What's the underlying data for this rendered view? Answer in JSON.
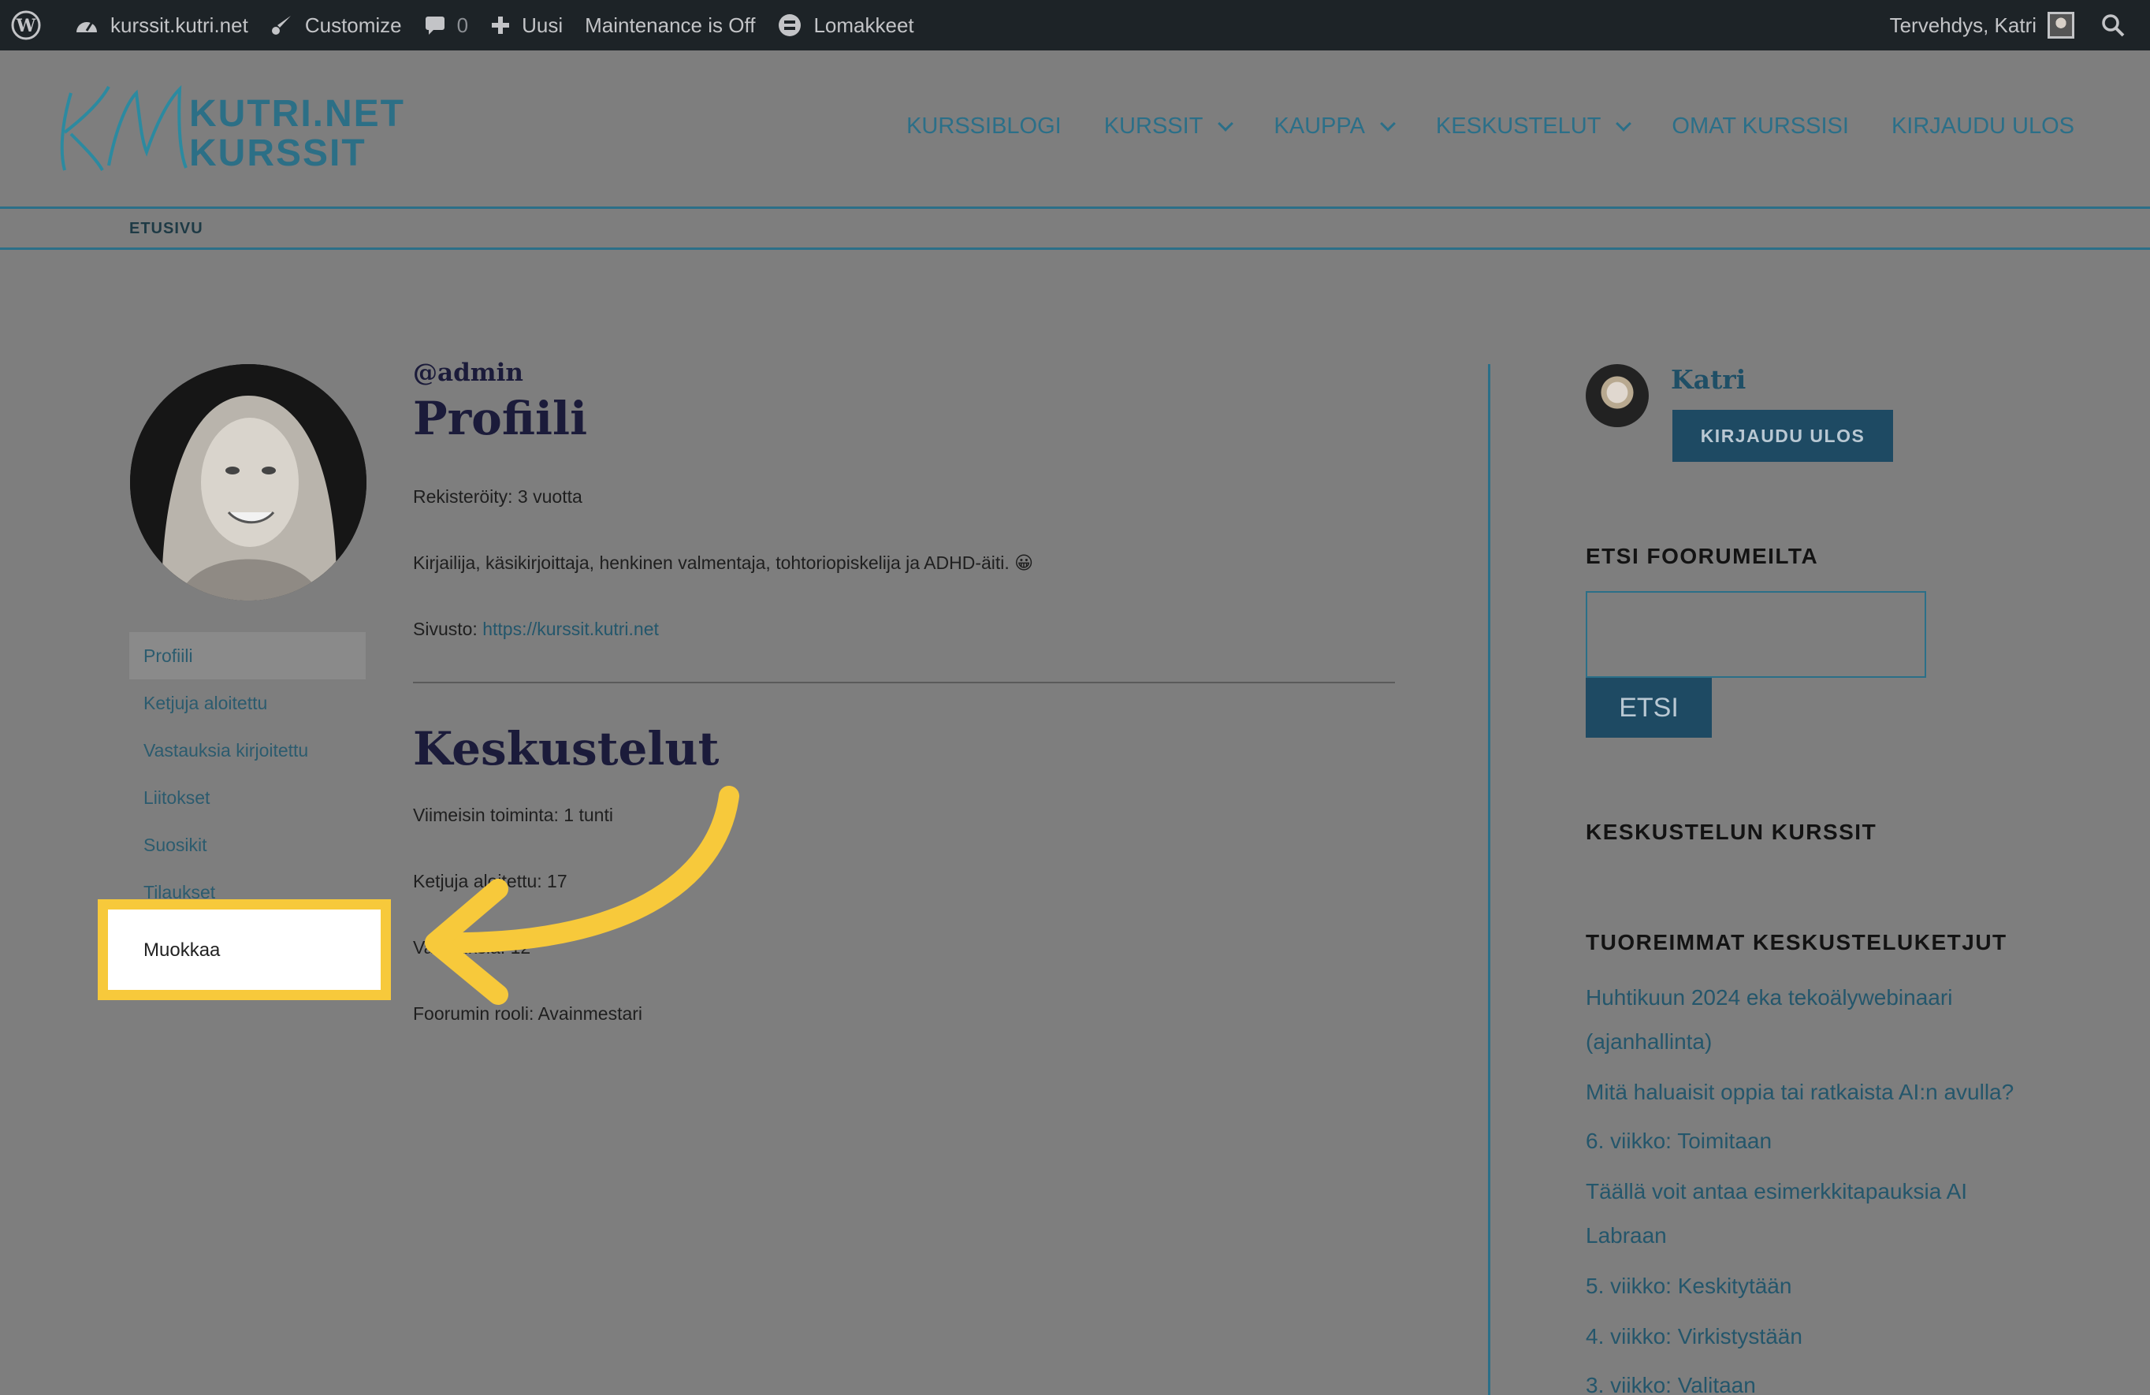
{
  "admin_bar": {
    "site_name": "kurssit.kutri.net",
    "customize": "Customize",
    "comments_count": "0",
    "new": "Uusi",
    "maintenance": "Maintenance is Off",
    "forms": "Lomakkeet",
    "greeting": "Tervehdys, Katri"
  },
  "header": {
    "logo_line1": "KUTRI.NET",
    "logo_line2": "KURSSIT",
    "nav": [
      {
        "label": "KURSSIBLOGI"
      },
      {
        "label": "KURSSIT"
      },
      {
        "label": "KAUPPA"
      },
      {
        "label": "KESKUSTELUT"
      },
      {
        "label": "OMAT KURSSISI"
      },
      {
        "label": "KIRJAUDU ULOS"
      }
    ]
  },
  "breadcrumb": "ETUSIVU",
  "profile_menu": {
    "items": [
      "Profiili",
      "Ketjuja aloitettu",
      "Vastauksia kirjoitettu",
      "Liitokset",
      "Suosikit",
      "Tilaukset"
    ],
    "highlighted": "Muokkaa"
  },
  "main": {
    "handle": "@admin",
    "title": "Profiili",
    "registered": "Rekisteröity: 3 vuotta",
    "bio": "Kirjailija, käsikirjoittaja, henkinen valmentaja, tohtoriopiskelija ja ADHD-äiti. 😀",
    "website_label": "Sivusto: ",
    "website_url": "https://kurssit.kutri.net",
    "forums_title": "Keskustelut",
    "last_activity": "Viimeisin toiminta: 1 tunti",
    "topics_started": "Ketjuja aloitettu: 17",
    "replies": "Vastauksia: 12",
    "forum_role": "Foorumin rooli: Avainmestari"
  },
  "sidebar": {
    "user_name": "Katri",
    "logout_button": "KIRJAUDU ULOS",
    "search_heading": "ETSI FOORUMEILTA",
    "search_button": "ETSI",
    "courses_heading": "KESKUSTELUN KURSSIT",
    "latest_heading": "TUOREIMMAT KESKUSTELUKETJUT",
    "topics": [
      "Huhtikuun 2024 eka tekoälywebinaari (ajanhallinta)",
      "Mitä haluaisit oppia tai ratkaista AI:n avulla?",
      "6. viikko: Toimitaan",
      "Täällä voit antaa esimerkkitapauksia AI Labraan",
      "5. viikko: Keskitytään",
      "4. viikko: Virkistystään",
      "3. viikko: Valitaan"
    ]
  },
  "colors": {
    "accent": "#2b6f88",
    "highlight": "#f7c93b",
    "button": "#1e4a63"
  }
}
